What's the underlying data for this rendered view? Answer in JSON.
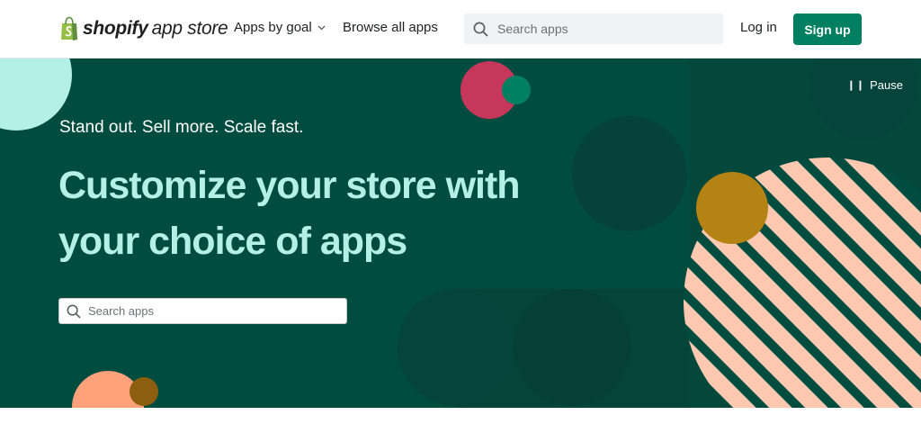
{
  "header": {
    "logo": {
      "brand": "shopify",
      "suffix": "app store",
      "icon": "shopping-bag-icon",
      "color": "#95bf47"
    },
    "nav": {
      "apps_by_goal": "Apps by goal",
      "browse_all": "Browse all apps"
    },
    "search": {
      "placeholder": "Search apps",
      "icon": "search-icon"
    },
    "login": "Log in",
    "signup": "Sign up"
  },
  "hero": {
    "pause": {
      "icon": "pause-icon",
      "label": "Pause"
    },
    "tagline": "Stand out. Sell more. Scale fast.",
    "headline": "Customize your store with your choice of apps",
    "search": {
      "placeholder": "Search apps",
      "icon": "search-icon"
    }
  },
  "colors": {
    "brand_green": "#008060",
    "hero_bg": "#004c3f",
    "headline": "#b4f0e5",
    "accent_pink": "#c6375b",
    "accent_gold": "#b58314",
    "accent_peach": "#ffa27c",
    "stripes": "#ffc8b1"
  }
}
